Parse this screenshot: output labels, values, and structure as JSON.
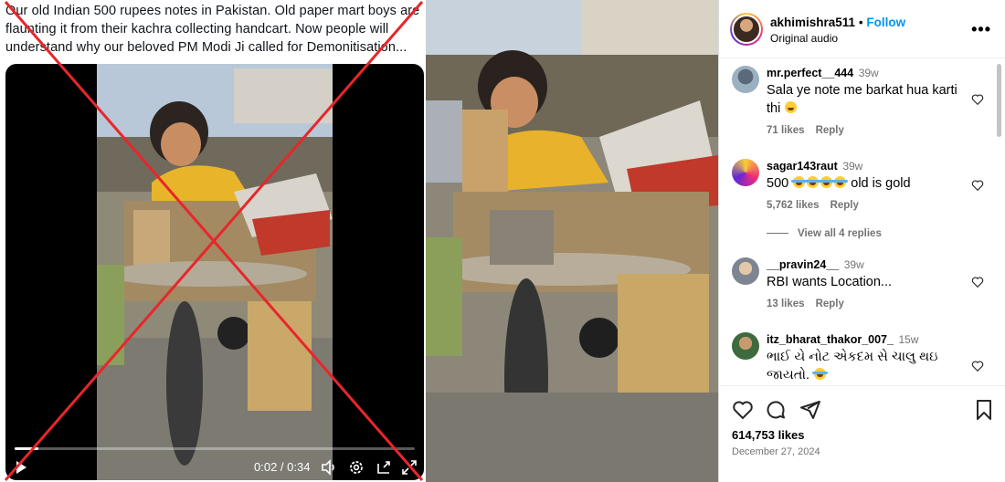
{
  "tweet": {
    "text": "Our old Indian 500 rupees notes in Pakistan. Old paper mart boys are flaunting it from their kachra collecting handcart. Now people will understand why our beloved PM Modi Ji called for Demonitisation..."
  },
  "video": {
    "time": "0:02 / 0:34",
    "progress": 0.06,
    "controls": [
      "play-icon",
      "volume-icon",
      "settings-icon",
      "pip-icon",
      "fullscreen-icon"
    ]
  },
  "instagram": {
    "username": "akhimishra511",
    "follow_label": "Follow",
    "audio": "Original audio",
    "comments": [
      {
        "user": "mr.perfect__444",
        "age": "39w",
        "text": "Sala ye note me barkat hua karti thi",
        "likes": "71 likes",
        "reply": "Reply"
      },
      {
        "user": "sagar143raut",
        "age": "39w",
        "text": "500",
        "text_suffix": "old is gold",
        "likes": "5,762 likes",
        "reply": "Reply",
        "view_replies": "View all 4 replies"
      },
      {
        "user": "__pravin24__",
        "age": "39w",
        "text": "RBI wants Location...",
        "likes": "13 likes",
        "reply": "Reply"
      },
      {
        "user": "itz_bharat_thakor_007_",
        "age": "15w",
        "text": "ભાઈ યે નોટ એકદમ સે ચાલુ થઇ જાયતો.",
        "likes": "",
        "reply": ""
      }
    ],
    "likes_total": "614,753 likes",
    "date": "December 27, 2024"
  },
  "colors": {
    "follow": "#0095f6",
    "cross": "#e8262b"
  }
}
